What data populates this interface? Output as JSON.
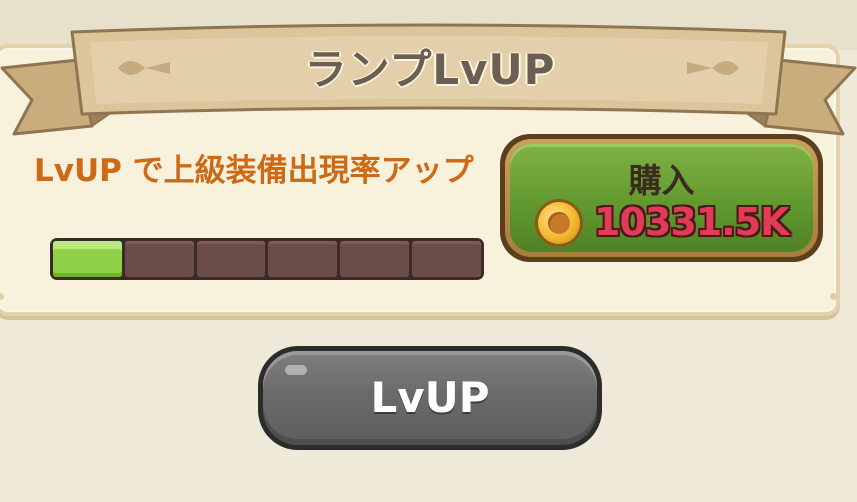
{
  "panel": {
    "title": "ランプLvUP",
    "description": "LvUP で上級装備出現率アップ",
    "progress": {
      "filled_segments": 1,
      "total_segments": 6
    }
  },
  "buy_button": {
    "label": "購入",
    "price": "10331.5K",
    "currency_icon": "coin-icon"
  },
  "lvup_button": {
    "label": "LvUP"
  },
  "colors": {
    "description_text": "#cc6a16",
    "buy_button": "#62992f",
    "price_text": "#e23b57",
    "lvup_button": "#6a6a6a",
    "progress_filled": "#8fd24a",
    "progress_empty": "#6a4d48"
  }
}
